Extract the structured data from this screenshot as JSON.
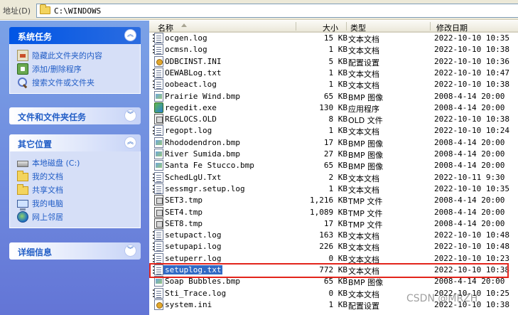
{
  "address": {
    "label": "地址(D)",
    "path": "C:\\WINDOWS"
  },
  "task_groups": [
    {
      "title": "系统任务",
      "collapsed": false,
      "items": [
        {
          "label": "隐藏此文件夹的内容",
          "icon": "share-folder-icon"
        },
        {
          "label": "添加/删除程序",
          "icon": "add-remove-programs-icon"
        },
        {
          "label": "搜索文件或文件夹",
          "icon": "search-icon"
        }
      ]
    },
    {
      "title": "文件和文件夹任务",
      "collapsed": true,
      "items": []
    },
    {
      "title": "其它位置",
      "collapsed": false,
      "items": [
        {
          "label": "本地磁盘 (C:)",
          "icon": "drive-icon"
        },
        {
          "label": "我的文档",
          "icon": "folder-icon"
        },
        {
          "label": "共享文档",
          "icon": "folder-icon"
        },
        {
          "label": "我的电脑",
          "icon": "computer-icon"
        },
        {
          "label": "网上邻居",
          "icon": "network-icon"
        }
      ]
    },
    {
      "title": "详细信息",
      "collapsed": true,
      "items": []
    }
  ],
  "columns": {
    "name": "名称",
    "size": "大小",
    "type": "类型",
    "modified": "修改日期"
  },
  "files": [
    {
      "name": "ocgen.log",
      "size": "15 KB",
      "type": "文本文档",
      "modified": "2022-10-10 10:35",
      "icon": "text"
    },
    {
      "name": "ocmsn.log",
      "size": "1 KB",
      "type": "文本文档",
      "modified": "2022-10-10 10:38",
      "icon": "text"
    },
    {
      "name": "ODBCINST.INI",
      "size": "5 KB",
      "type": "配置设置",
      "modified": "2022-10-10 10:36",
      "icon": "ini"
    },
    {
      "name": "OEWABLog.txt",
      "size": "1 KB",
      "type": "文本文档",
      "modified": "2022-10-10 10:47",
      "icon": "text"
    },
    {
      "name": "oobeact.log",
      "size": "1 KB",
      "type": "文本文档",
      "modified": "2022-10-10 10:38",
      "icon": "text"
    },
    {
      "name": "Prairie Wind.bmp",
      "size": "65 KB",
      "type": "BMP 图像",
      "modified": "2008-4-14 20:00",
      "icon": "bmp"
    },
    {
      "name": "regedit.exe",
      "size": "130 KB",
      "type": "应用程序",
      "modified": "2008-4-14 20:00",
      "icon": "exe"
    },
    {
      "name": "REGLOCS.OLD",
      "size": "8 KB",
      "type": "OLD 文件",
      "modified": "2022-10-10 10:38",
      "icon": "sys"
    },
    {
      "name": "regopt.log",
      "size": "1 KB",
      "type": "文本文档",
      "modified": "2022-10-10 10:24",
      "icon": "text"
    },
    {
      "name": "Rhododendron.bmp",
      "size": "17 KB",
      "type": "BMP 图像",
      "modified": "2008-4-14 20:00",
      "icon": "bmp"
    },
    {
      "name": "River Sumida.bmp",
      "size": "27 KB",
      "type": "BMP 图像",
      "modified": "2008-4-14 20:00",
      "icon": "bmp"
    },
    {
      "name": "Santa Fe Stucco.bmp",
      "size": "65 KB",
      "type": "BMP 图像",
      "modified": "2008-4-14 20:00",
      "icon": "bmp"
    },
    {
      "name": "SchedLgU.Txt",
      "size": "2 KB",
      "type": "文本文档",
      "modified": "2022-10-11 9:30",
      "icon": "text"
    },
    {
      "name": "sessmgr.setup.log",
      "size": "1 KB",
      "type": "文本文档",
      "modified": "2022-10-10 10:35",
      "icon": "text"
    },
    {
      "name": "SET3.tmp",
      "size": "1,216 KB",
      "type": "TMP 文件",
      "modified": "2008-4-14 20:00",
      "icon": "sys"
    },
    {
      "name": "SET4.tmp",
      "size": "1,089 KB",
      "type": "TMP 文件",
      "modified": "2008-4-14 20:00",
      "icon": "sys"
    },
    {
      "name": "SET8.tmp",
      "size": "17 KB",
      "type": "TMP 文件",
      "modified": "2008-4-14 20:00",
      "icon": "sys"
    },
    {
      "name": "setupact.log",
      "size": "163 KB",
      "type": "文本文档",
      "modified": "2022-10-10 10:48",
      "icon": "text"
    },
    {
      "name": "setupapi.log",
      "size": "226 KB",
      "type": "文本文档",
      "modified": "2022-10-10 10:48",
      "icon": "text"
    },
    {
      "name": "setuperr.log",
      "size": "0 KB",
      "type": "文本文档",
      "modified": "2022-10-10 10:23",
      "icon": "text"
    },
    {
      "name": "setuplog.txt",
      "size": "772 KB",
      "type": "文本文档",
      "modified": "2022-10-10 10:38",
      "icon": "text",
      "selected": true
    },
    {
      "name": "Soap Bubbles.bmp",
      "size": "65 KB",
      "type": "BMP 图像",
      "modified": "2008-4-14 20:00",
      "icon": "bmp"
    },
    {
      "name": "Sti_Trace.log",
      "size": "0 KB",
      "type": "文本文档",
      "modified": "2022-10-10 10:25",
      "icon": "text"
    },
    {
      "name": "system.ini",
      "size": "1 KB",
      "type": "配置设置",
      "modified": "2022-10-10 10:38",
      "icon": "ini"
    }
  ],
  "watermark": "CSDN @MRZH"
}
